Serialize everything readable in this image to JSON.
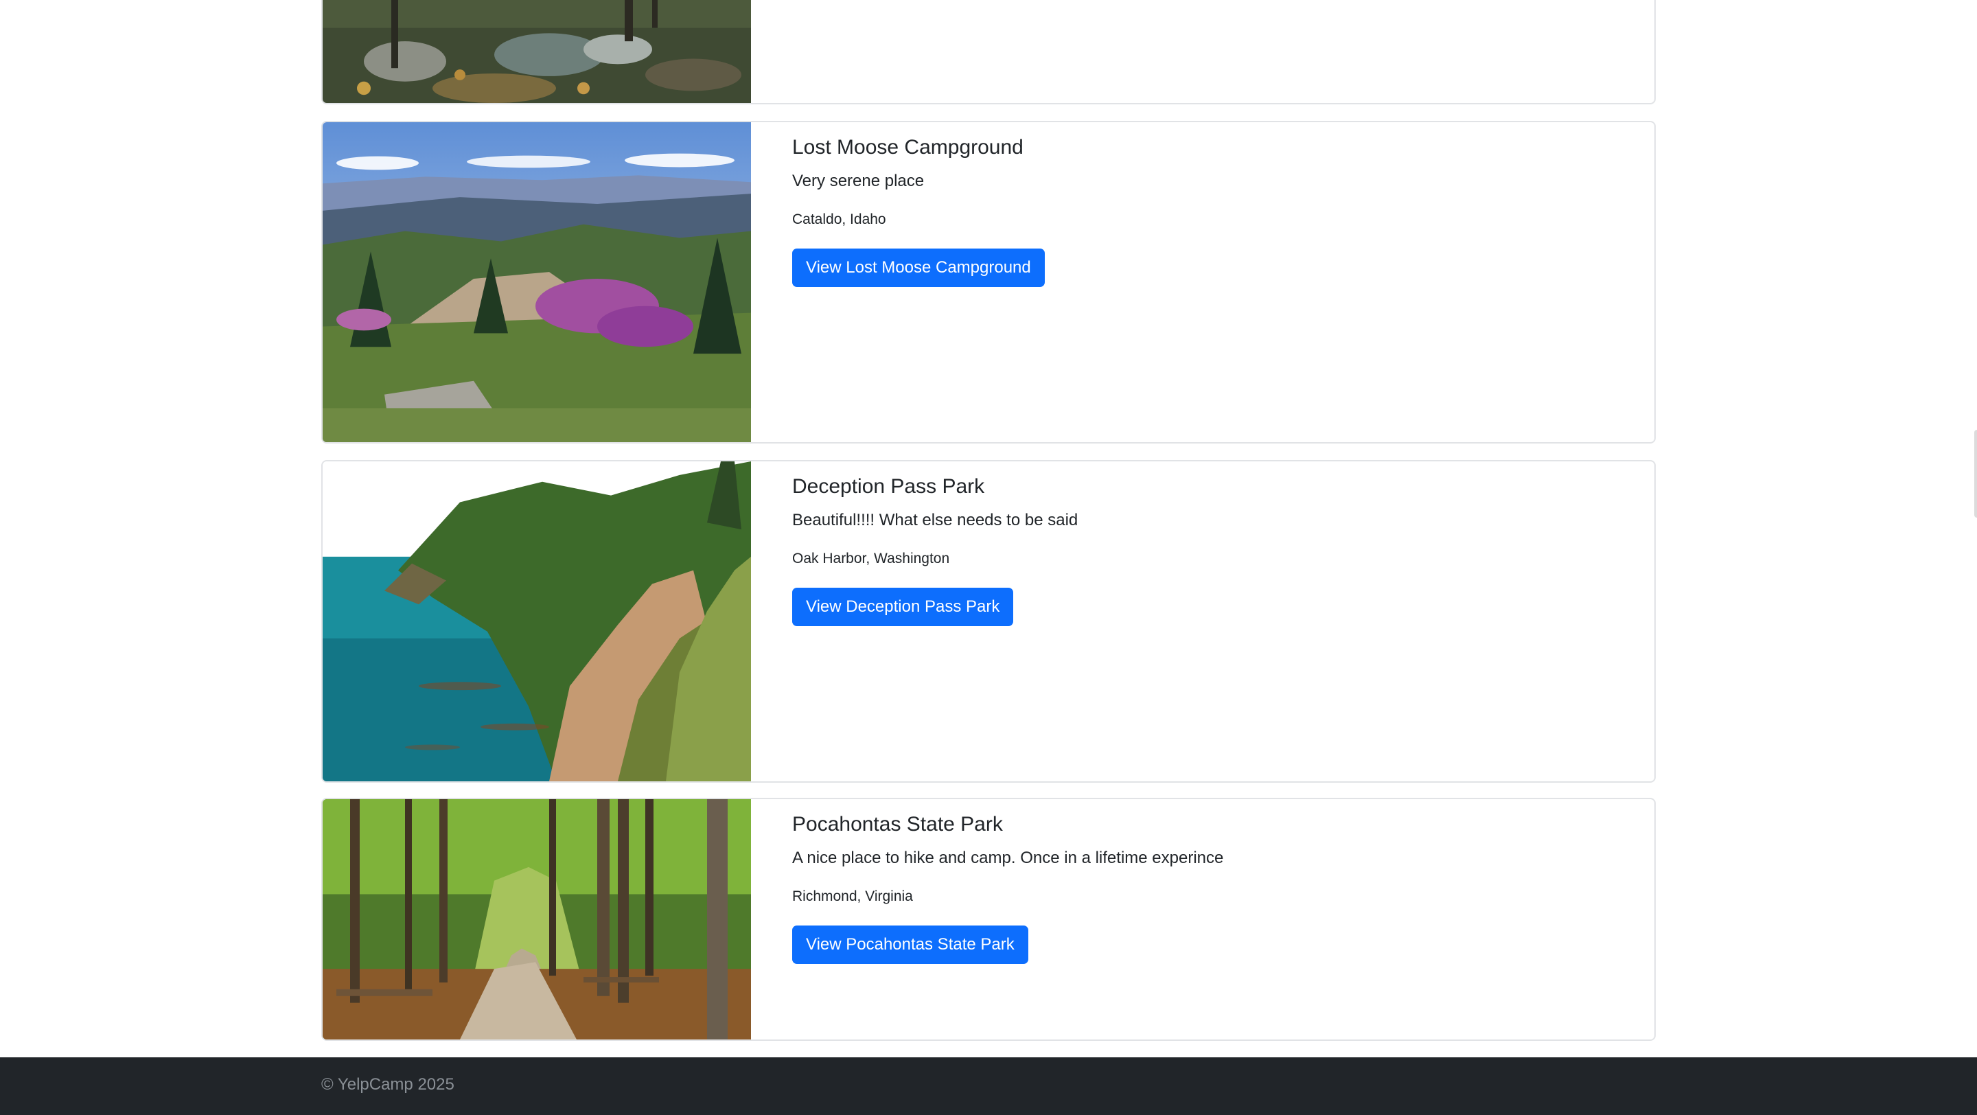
{
  "campgrounds": [
    {
      "title": "",
      "description": "",
      "location": "",
      "button_label": ""
    },
    {
      "title": "Lost Moose Campground",
      "description": "Very serene place",
      "location": "Cataldo, Idaho",
      "button_label": "View Lost Moose Campground"
    },
    {
      "title": "Deception Pass Park",
      "description": "Beautiful!!!! What else needs to be said",
      "location": "Oak Harbor, Washington",
      "button_label": "View Deception Pass Park"
    },
    {
      "title": "Pocahontas State Park",
      "description": "A nice place to hike and camp. Once in a lifetime experince",
      "location": "Richmond, Virginia",
      "button_label": "View Pocahontas State Park"
    }
  ],
  "footer": {
    "copyright": "© YelpCamp 2025"
  },
  "colors": {
    "button": "#0d6efd",
    "footer_bg": "#212529",
    "footer_text": "#8a9096",
    "card_border": "#e1e3e6"
  }
}
